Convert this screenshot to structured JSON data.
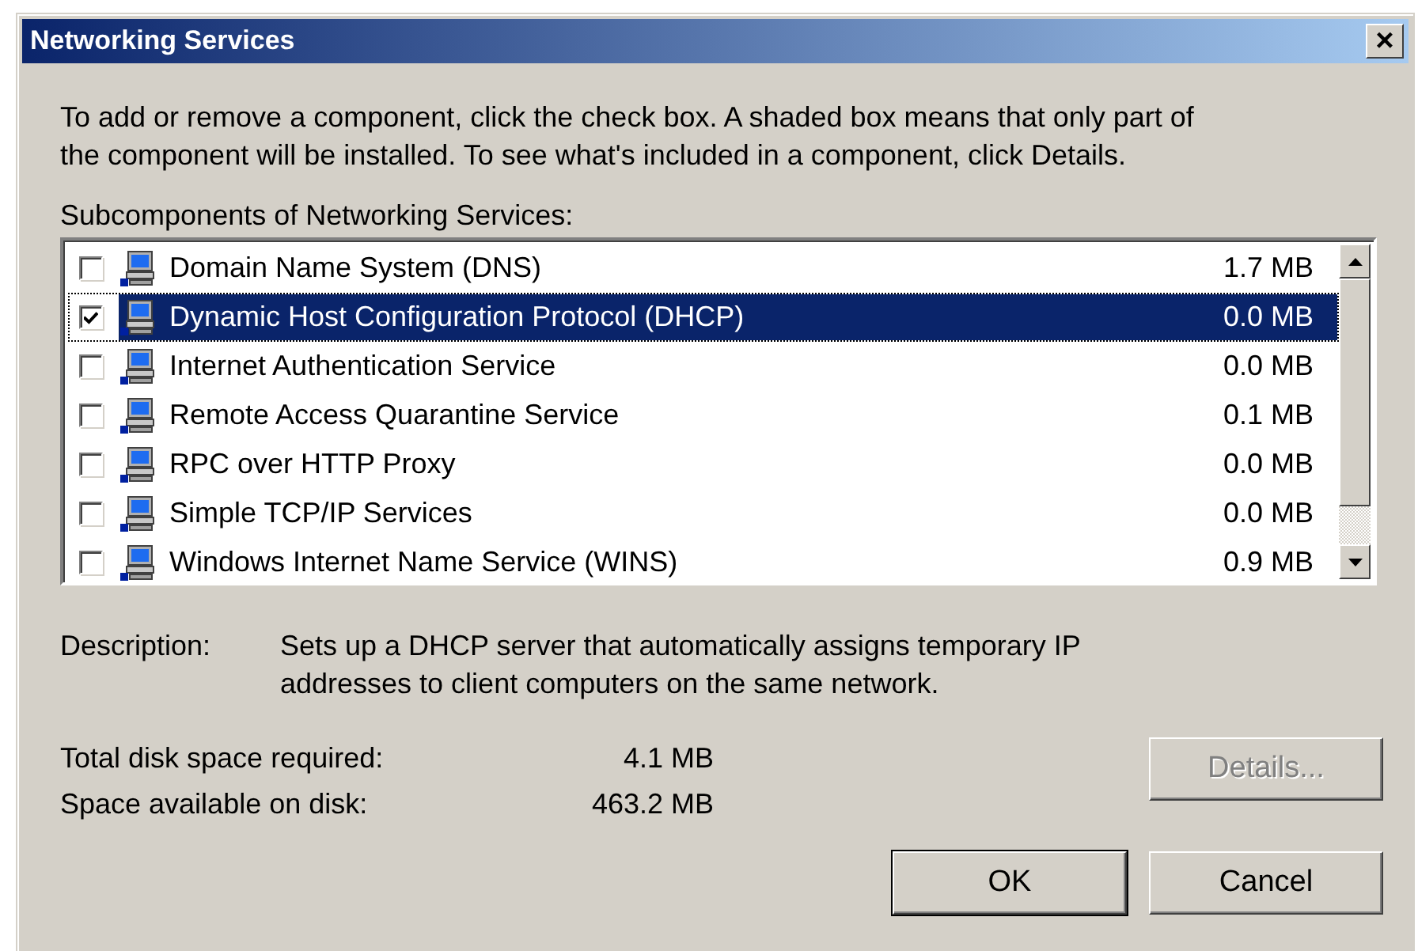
{
  "window": {
    "title": "Networking Services",
    "close_button": "×"
  },
  "instructions": "To add or remove a component, click the check box. A shaded box means that only part of the component will be installed. To see what's included in a component, click Details.",
  "list_label": "Subcomponents of Networking Services:",
  "components": [
    {
      "name": "Domain Name System (DNS)",
      "size": "1.7 MB",
      "checked": false,
      "selected": false
    },
    {
      "name": "Dynamic Host Configuration Protocol (DHCP)",
      "size": "0.0 MB",
      "checked": true,
      "selected": true
    },
    {
      "name": "Internet Authentication Service",
      "size": "0.0 MB",
      "checked": false,
      "selected": false
    },
    {
      "name": "Remote Access Quarantine Service",
      "size": "0.1 MB",
      "checked": false,
      "selected": false
    },
    {
      "name": "RPC over HTTP Proxy",
      "size": "0.0 MB",
      "checked": false,
      "selected": false
    },
    {
      "name": "Simple TCP/IP Services",
      "size": "0.0 MB",
      "checked": false,
      "selected": false
    },
    {
      "name": "Windows Internet Name Service (WINS)",
      "size": "0.9 MB",
      "checked": false,
      "selected": false
    }
  ],
  "description": {
    "label": "Description:",
    "text": "Sets up a DHCP server that automatically assigns temporary IP addresses to client computers on the same network."
  },
  "disk": [
    {
      "label": "Total disk space required:",
      "value": "4.1 MB"
    },
    {
      "label": "Space available on disk:",
      "value": "463.2 MB"
    }
  ],
  "buttons": [
    {
      "label": "Details...",
      "kind": "details",
      "disabled": true
    },
    {
      "label": "OK",
      "kind": "ok",
      "disabled": false
    },
    {
      "label": "Cancel",
      "kind": "cancel",
      "disabled": false
    }
  ]
}
